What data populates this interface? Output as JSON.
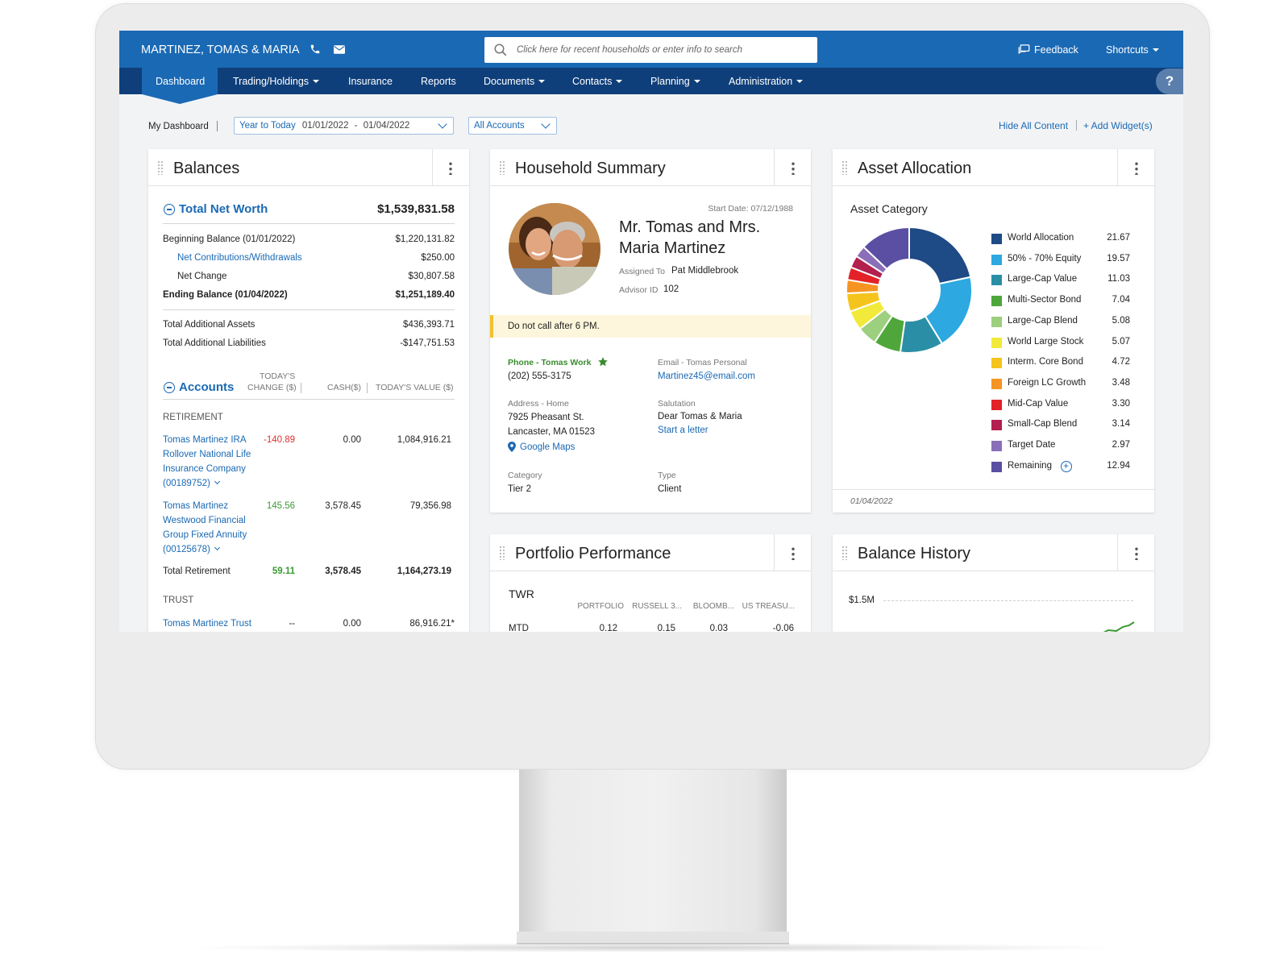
{
  "header": {
    "household": "MARTINEZ, TOMAS & MARIA",
    "search_placeholder": "Click here for recent households or enter info to search",
    "feedback": "Feedback",
    "shortcuts": "Shortcuts"
  },
  "nav": {
    "items": [
      "Dashboard",
      "Trading/Holdings",
      "Insurance",
      "Reports",
      "Documents",
      "Contacts",
      "Planning",
      "Administration"
    ],
    "help": "?"
  },
  "toolbar": {
    "my_dashboard": "My Dashboard",
    "period_label": "Year to Today",
    "date_from": "01/01/2022",
    "date_sep": "-",
    "date_to": "01/04/2022",
    "accounts": "All Accounts",
    "hide_all": "Hide All Content",
    "add_widgets": "+ Add Widget(s)"
  },
  "balances": {
    "title": "Balances",
    "total_net_worth_label": "Total Net Worth",
    "total_net_worth": "$1,539,831.58",
    "rows": [
      {
        "label": "Beginning Balance (01/01/2022)",
        "value": "$1,220,131.82"
      },
      {
        "label": "Net Contributions/Withdrawals",
        "value": "$250.00"
      },
      {
        "label": "Net Change",
        "value": "$30,807.58"
      },
      {
        "label": "Ending Balance (01/04/2022)",
        "value": "$1,251,189.40"
      },
      {
        "label": "Total Additional Assets",
        "value": "$436,393.71"
      },
      {
        "label": "Total Additional Liabilities",
        "value": "-$147,751.53"
      }
    ],
    "accounts_label": "Accounts",
    "col_change_1": "TODAY'S",
    "col_change_2": "CHANGE ($)",
    "col_cash": "CASH($)",
    "col_value": "TODAY'S VALUE ($)",
    "retirement_label": "RETIREMENT",
    "account1": {
      "l1": "Tomas Martinez IRA",
      "l2": "Rollover National Life",
      "l3": "Insurance Company",
      "l4": "(00189752)",
      "change": "-140.89",
      "cash": "0.00",
      "value": "1,084,916.21"
    },
    "account2": {
      "l1": "Tomas Martinez",
      "l2": "Westwood Financial",
      "l3": "Group Fixed Annuity",
      "l4": "(00125678)",
      "change": "145.56",
      "cash": "3,578.45",
      "value": "79,356.98"
    },
    "total_ret": {
      "label": "Total Retirement",
      "change": "59.11",
      "cash": "3,578.45",
      "value": "1,164,273.19"
    },
    "trust_label": "TRUST",
    "trust": {
      "name": "Tomas Martinez Trust",
      "change": "--",
      "cash": "0.00",
      "value": "86,916.21*"
    }
  },
  "household": {
    "title": "Household Summary",
    "start_date": "Start Date: 07/12/1988",
    "name_l1": "Mr. Tomas and Mrs.",
    "name_l2": "Maria Martinez",
    "assigned_label": "Assigned To",
    "assigned": "Pat Middlebrook",
    "advisor_label": "Advisor ID",
    "advisor": "102",
    "note": "Do not call after 6 PM.",
    "phone_label": "Phone - Tomas Work",
    "phone": "(202) 555-3175",
    "email_label": "Email - Tomas Personal",
    "email": "Martinez45@email.com",
    "address_label": "Address - Home",
    "address_l1": "7925 Pheasant St.",
    "address_l2": "Lancaster, MA 01523",
    "maps": "Google Maps",
    "salutation_label": "Salutation",
    "salutation": "Dear Tomas & Maria",
    "start_letter": "Start a letter",
    "category_label": "Category",
    "category": "Tier 2",
    "type_label": "Type",
    "type": "Client"
  },
  "allocation": {
    "title": "Asset Allocation",
    "subtitle": "Asset Category",
    "date": "01/04/2022"
  },
  "chart_data": {
    "type": "pie",
    "donut": true,
    "title": "Asset Category",
    "categories": [
      "World Allocation",
      "50% - 70% Equity",
      "Large-Cap Value",
      "Multi-Sector Bond",
      "Large-Cap Blend",
      "World Large Stock",
      "Interm. Core Bond",
      "Foreign LC Growth",
      "Mid-Cap Value",
      "Small-Cap Blend",
      "Target Date",
      "Remaining"
    ],
    "values": [
      21.67,
      19.57,
      11.03,
      7.04,
      5.08,
      5.07,
      4.72,
      3.48,
      3.3,
      3.14,
      2.97,
      12.94
    ],
    "labels": [
      "21.67",
      "19.57",
      "11.03",
      "7.04",
      "5.08",
      "5.07",
      "4.72",
      "3.48",
      "3.30",
      "3.14",
      "2.97",
      "12.94"
    ],
    "colors": [
      "#1e4a86",
      "#2da8e0",
      "#2a8fa6",
      "#4fa73c",
      "#9ccf7e",
      "#f2ea3a",
      "#f5c41c",
      "#f59422",
      "#e32228",
      "#b31f4f",
      "#8a6fb8",
      "#5a4fa3"
    ]
  },
  "performance": {
    "title": "Portfolio Performance",
    "twr": "TWR",
    "cols": [
      "PORTFOLIO",
      "RUSSELL 3...",
      "BLOOMB...",
      "US TREASU..."
    ],
    "row_label": "MTD",
    "row": [
      "0.12",
      "0.15",
      "0.03",
      "-0.06"
    ]
  },
  "balance_history": {
    "title": "Balance History",
    "y_label": "$1.5M"
  }
}
